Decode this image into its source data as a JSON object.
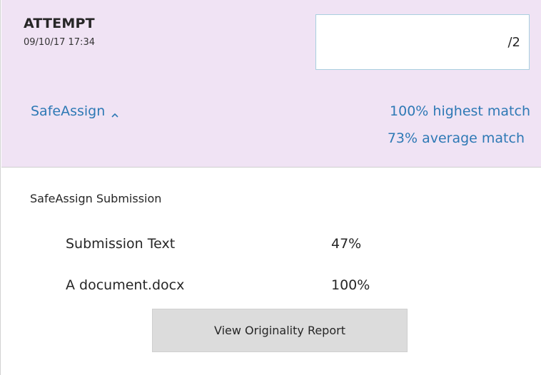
{
  "attempt": {
    "label": "ATTEMPT",
    "date": "09/10/17 17:34",
    "grade_value": "",
    "grade_max": "/2"
  },
  "safeassign": {
    "toggle_label": "SafeAssign",
    "highest_match": "100% highest match",
    "average_match": "73% average match",
    "submission_title": "SafeAssign Submission",
    "files": [
      {
        "name": "Submission Text",
        "match": "47%"
      },
      {
        "name": "A document.docx",
        "match": "100%"
      }
    ],
    "report_button_label": "View Originality Report"
  },
  "colors": {
    "header_background": "#f0e3f4",
    "link": "#2e79b5",
    "button_background": "#dcdcdc"
  }
}
